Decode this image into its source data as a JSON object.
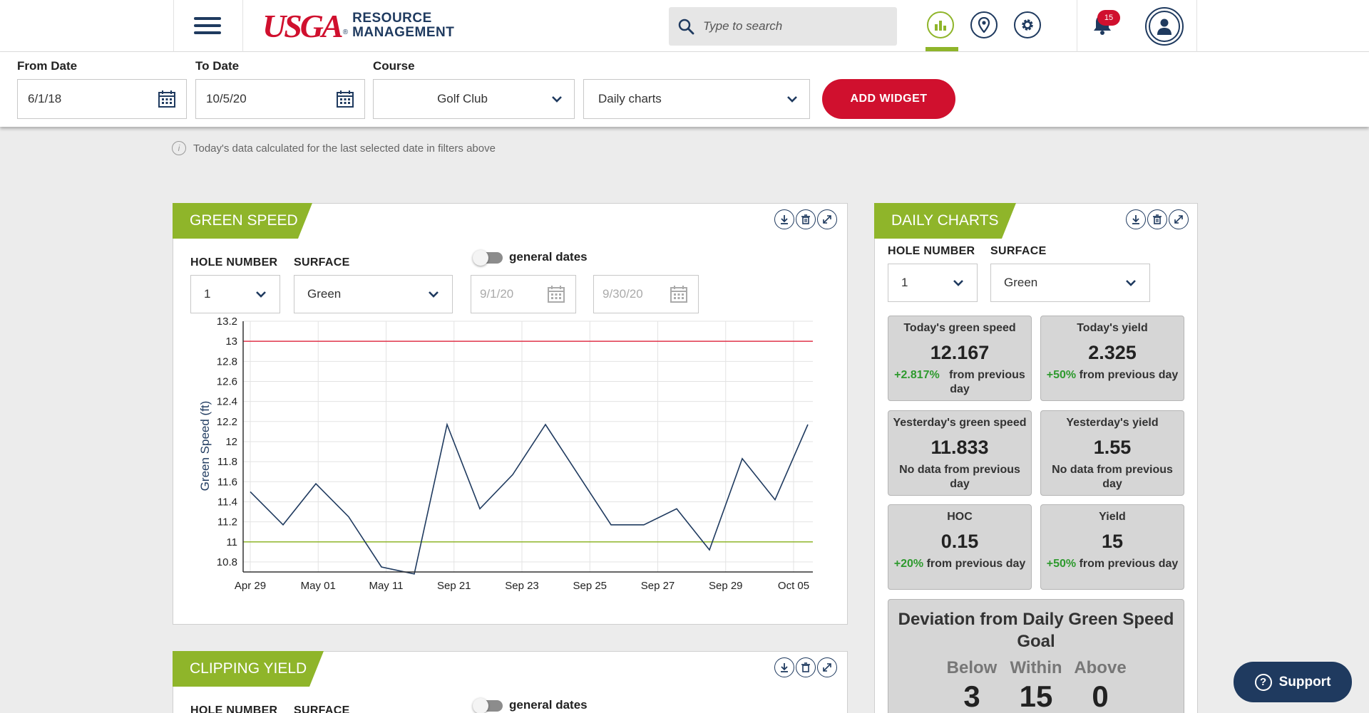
{
  "header": {
    "logo_brand": "USGA",
    "logo_line1": "RESOURCE",
    "logo_line2": "MANAGEMENT",
    "search_placeholder": "Type to search",
    "notification_count": "15",
    "accent": "#8fb52a",
    "brand_red": "#d0102e",
    "navy": "#1f3a5f"
  },
  "filters": {
    "from_label": "From Date",
    "from_value": "6/1/18",
    "to_label": "To Date",
    "to_value": "10/5/20",
    "course_label": "Course",
    "course_value": "Golf Club",
    "widget_value": "Daily charts",
    "add_widget_label": "ADD WIDGET"
  },
  "info_note": "Today's data calculated for the last selected date in filters above",
  "green_speed": {
    "title": "GREEN SPEED",
    "hole_label": "HOLE NUMBER",
    "hole_value": "1",
    "surface_label": "SURFACE",
    "surface_value": "Green",
    "toggle_label": "general dates",
    "start_date": "9/1/20",
    "end_date": "9/30/20"
  },
  "clipping_yield": {
    "title": "CLIPPING YIELD",
    "hole_label": "HOLE NUMBER",
    "surface_label": "SURFACE",
    "toggle_label": "general dates"
  },
  "daily_charts": {
    "title": "DAILY CHARTS",
    "hole_label": "HOLE NUMBER",
    "hole_value": "1",
    "surface_label": "SURFACE",
    "surface_value": "Green",
    "tiles": [
      {
        "title": "Today's green speed",
        "value": "12.167",
        "delta": "+2.817%",
        "delta_text": "from previous day"
      },
      {
        "title": "Today's yield",
        "value": "2.325",
        "delta": "+50%",
        "delta_text": "from previous day"
      },
      {
        "title": "Yesterday's green speed",
        "value": "11.833",
        "delta": "",
        "delta_text": "No data from previous day"
      },
      {
        "title": "Yesterday's yield",
        "value": "1.55",
        "delta": "",
        "delta_text": "No data from previous day"
      },
      {
        "title": "HOC",
        "value": "0.15",
        "delta": "+20%",
        "delta_text": "from previous day"
      },
      {
        "title": "Yield",
        "value": "15",
        "delta": "+50%",
        "delta_text": "from previous day"
      }
    ],
    "deviation": {
      "title": "Deviation from Daily Green Speed Goal",
      "below_label": "Below",
      "below_value": "3",
      "within_label": "Within",
      "within_value": "15",
      "above_label": "Above",
      "above_value": "0"
    }
  },
  "support_label": "Support",
  "chart_data": {
    "type": "line",
    "ylabel": "Green Speed (ft)",
    "xlabel": "",
    "ylim": [
      10.7,
      13.2
    ],
    "yticks": [
      13.2,
      13,
      12.8,
      12.6,
      12.4,
      12.2,
      12,
      11.8,
      11.6,
      11.4,
      11.2,
      11,
      10.8
    ],
    "xtick_labels": [
      "Apr 29",
      "May 01",
      "May 11",
      "Sep 21",
      "Sep 23",
      "Sep 25",
      "Sep 27",
      "Sep 29",
      "Oct 05"
    ],
    "grid": true,
    "upper_threshold": 13,
    "lower_threshold": 11,
    "threshold_colors": {
      "upper": "#e0344a",
      "lower": "#8fb52a"
    },
    "line_color": "#1f3a5f",
    "series": [
      {
        "values": [
          11.5,
          11.17,
          11.58,
          11.25,
          10.75,
          10.68,
          12.17,
          11.33,
          11.67,
          12.17,
          11.67,
          11.17,
          11.17,
          11.33,
          10.92,
          11.83,
          11.42,
          12.17
        ]
      }
    ]
  }
}
